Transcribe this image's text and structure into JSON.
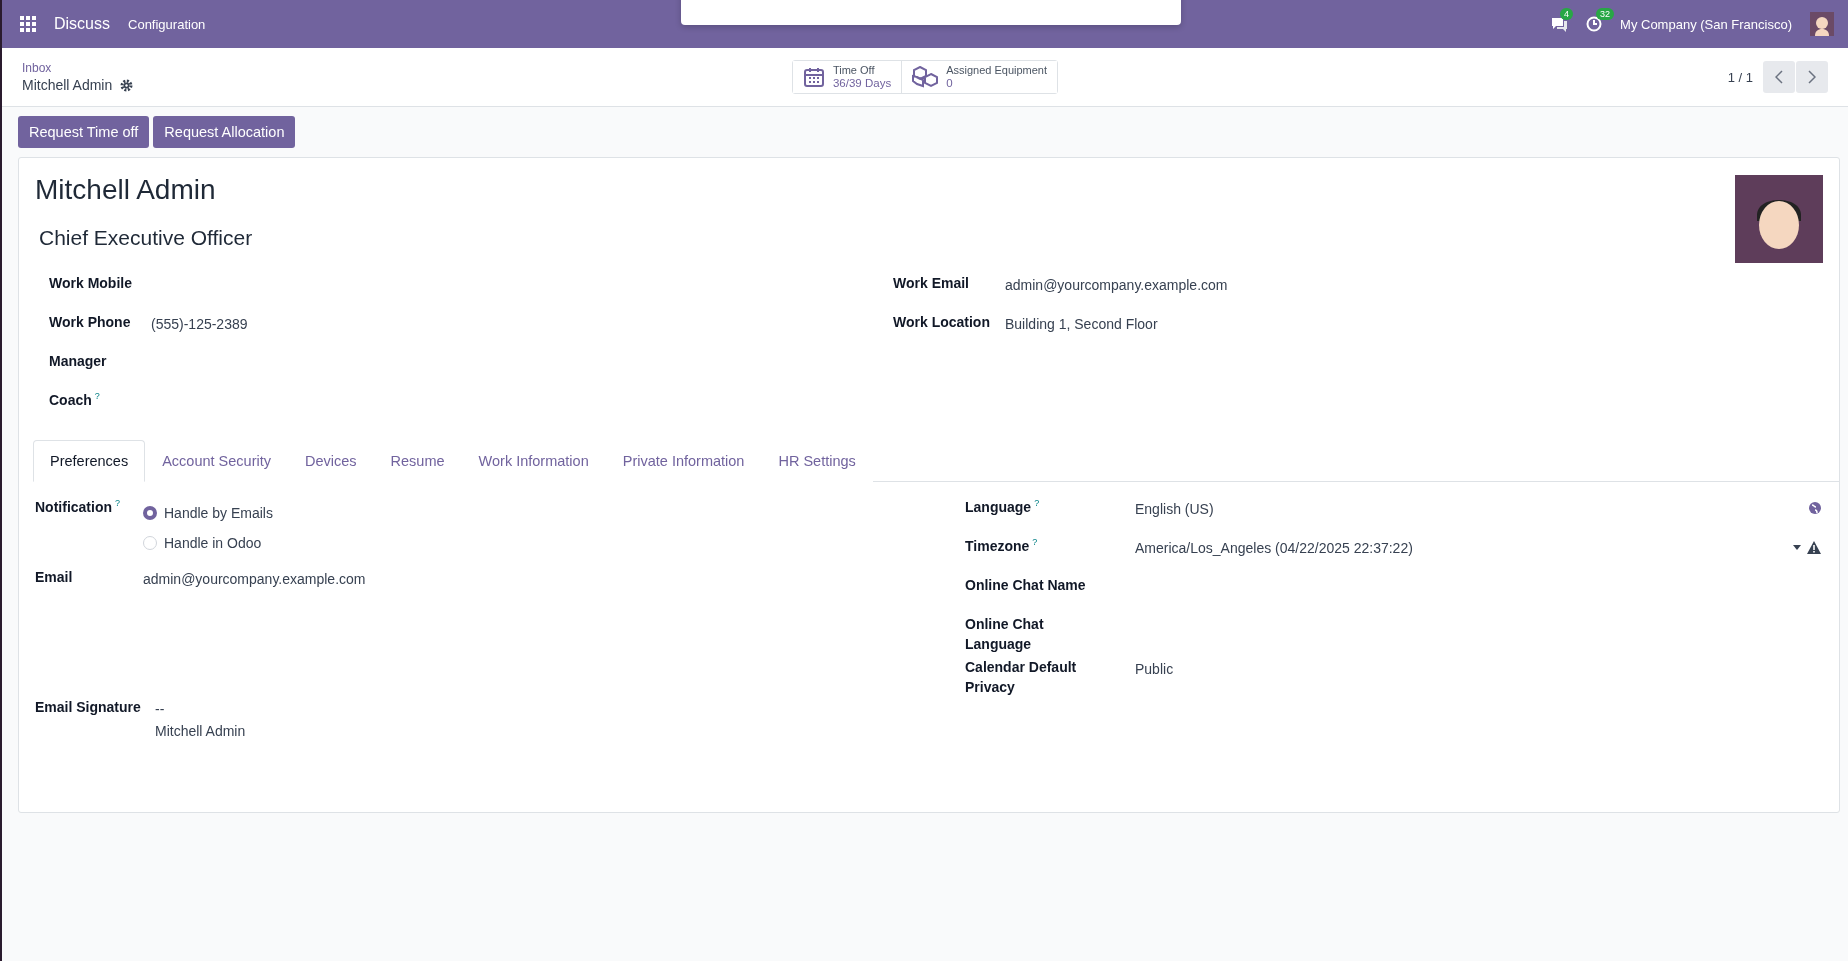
{
  "navbar": {
    "app": "Discuss",
    "menu": [
      "Configuration"
    ],
    "messages_count": "4",
    "activities_count": "32",
    "company": "My Company (San Francisco)"
  },
  "breadcrumb": {
    "parent": "Inbox",
    "current": "Mitchell Admin"
  },
  "smart_buttons": [
    {
      "kind": "calendar",
      "label": "Time Off",
      "value": "36/39 Days"
    },
    {
      "kind": "boxes",
      "label": "Assigned Equipment",
      "value": "0"
    }
  ],
  "pager": "1 / 1",
  "actions": [
    "Request Time off",
    "Request Allocation"
  ],
  "employee": {
    "name": "Mitchell Admin",
    "job_title": "Chief Executive Officer"
  },
  "fields_left": [
    {
      "label": "Work Mobile"
    },
    {
      "label": "Work Phone",
      "value": "(555)-125-2389"
    },
    {
      "label": "Manager"
    },
    {
      "label": "Coach",
      "help": "?"
    }
  ],
  "fields_right": [
    {
      "label": "Work Email",
      "value": "admin@yourcompany.example.com"
    },
    {
      "label": "Work Location",
      "value": "Building 1, Second Floor"
    }
  ],
  "tabs": [
    {
      "label": "Preferences",
      "selected": true
    },
    {
      "label": "Account Security",
      "selected": false
    },
    {
      "label": "Devices",
      "selected": false
    },
    {
      "label": "Resume",
      "selected": false
    },
    {
      "label": "Work Information",
      "selected": false
    },
    {
      "label": "Private Information",
      "selected": false
    },
    {
      "label": "HR Settings",
      "selected": false
    }
  ],
  "notification": {
    "label": "Notification",
    "help": "?",
    "options": [
      {
        "label": "Handle by Emails",
        "selected": true
      },
      {
        "label": "Handle in Odoo",
        "selected": false
      }
    ]
  },
  "email": {
    "label": "Email",
    "value": "admin@yourcompany.example.com"
  },
  "signature": {
    "label": "Email Signature",
    "lines": [
      "--",
      "Mitchell Admin"
    ]
  },
  "preferences_right": [
    {
      "label": "Language",
      "value": "English (US)",
      "help": "?",
      "kind": "globe"
    },
    {
      "label": "Timezone",
      "value": "America/Los_Angeles (04/22/2025 22:37:22)",
      "help": "?",
      "kind": "warning"
    },
    {
      "label": "Online Chat Name",
      "kind": "plain"
    },
    {
      "label": "Online Chat Language",
      "kind": "plain"
    },
    {
      "label": "Calendar Default Privacy",
      "value": "Public",
      "kind": "plain"
    }
  ]
}
